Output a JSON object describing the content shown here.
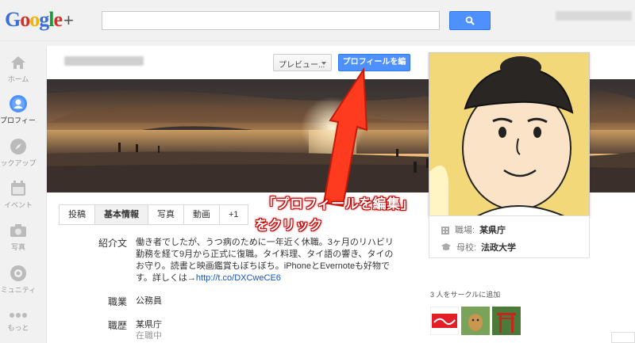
{
  "header": {
    "logo_text": "Google+",
    "search_placeholder": ""
  },
  "leftnav": [
    {
      "label": "ホーム",
      "icon": "home-icon"
    },
    {
      "label": "プロフィール",
      "icon": "profile-icon",
      "active": true
    },
    {
      "label": "ックアップ",
      "icon": "compass-icon"
    },
    {
      "label": "イベント",
      "icon": "calendar-icon"
    },
    {
      "label": "写真",
      "icon": "camera-icon"
    },
    {
      "label": "ミュニティ",
      "icon": "community-icon"
    },
    {
      "label": "もっと",
      "icon": "more-icon"
    }
  ],
  "toolbar": {
    "preview_label": "プレビュー...",
    "edit_label": "プロフィールを編集"
  },
  "tabs": [
    "投稿",
    "基本情報",
    "写真",
    "動画",
    "+1"
  ],
  "active_tab": "基本情報",
  "about": {
    "intro_label": "紹介文",
    "intro_text": "働き者でしたが、うつ病のために一年近く休職。3ヶ月のリハビリ勤務を経て9月から正式に復職。タイ料理、タイ語の響き、タイのお守り。読書と映画鑑賞もぼちぼち。iPhoneとEvernoteも好物です。詳しくは→",
    "intro_link": "http://t.co/DXCweCE6",
    "occupation_label": "職業",
    "occupation_value": "公務員",
    "employment_label": "職歴",
    "employment_value": "某県庁",
    "employment_status": "在職中"
  },
  "card": {
    "work_label": "職場:",
    "work_value": "某県庁",
    "school_label": "母校:",
    "school_value": "法政大学"
  },
  "circles": {
    "label": "3 人をサークルに追加"
  },
  "annotation": {
    "line1": "「プロフィールを編集」",
    "line2": "をクリック"
  },
  "colors": {
    "primary_button": "#4d90fe",
    "annotation_red": "#e8231e",
    "link": "#1155cc"
  }
}
